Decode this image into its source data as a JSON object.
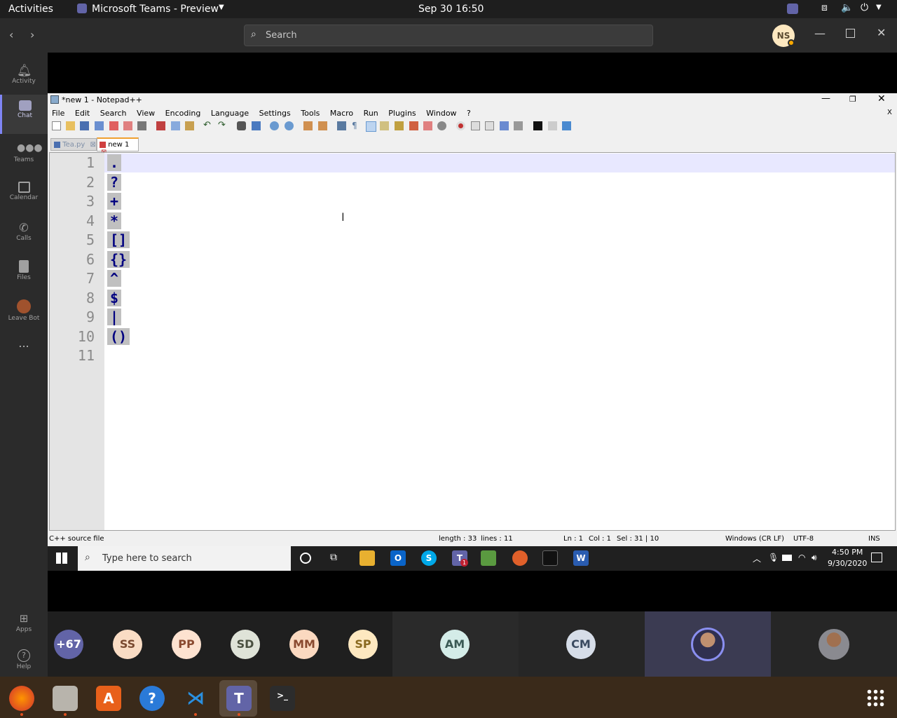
{
  "topbar": {
    "activities": "Activities",
    "app_name": "Microsoft Teams - Preview",
    "datetime": "Sep 30  16:50"
  },
  "teams": {
    "search_placeholder": "Search",
    "user_initials": "NS",
    "rail": [
      {
        "label": "Activity"
      },
      {
        "label": "Chat"
      },
      {
        "label": "Teams"
      },
      {
        "label": "Calendar"
      },
      {
        "label": "Calls"
      },
      {
        "label": "Files"
      },
      {
        "label": "Leave Bot"
      }
    ],
    "apps_label": "Apps",
    "help_label": "Help",
    "more_label": "..."
  },
  "notepad": {
    "title": "*new 1 - Notepad++",
    "menu": [
      "File",
      "Edit",
      "Search",
      "View",
      "Encoding",
      "Language",
      "Settings",
      "Tools",
      "Macro",
      "Run",
      "Plugins",
      "Window",
      "?"
    ],
    "tabs": [
      {
        "label": "Tea.py"
      },
      {
        "label": "new 1"
      }
    ],
    "line_numbers": [
      "1",
      "2",
      "3",
      "4",
      "5",
      "6",
      "7",
      "8",
      "9",
      "10",
      "11"
    ],
    "lines": [
      ".",
      "?",
      "+",
      "*",
      "[]",
      "{}",
      "^",
      "$",
      "|",
      "()",
      ""
    ],
    "status": {
      "type": "C++ source file",
      "length": "length : 33",
      "lines": "lines : 11",
      "ln": "Ln : 1",
      "col": "Col : 1",
      "sel": "Sel : 31 | 10",
      "eol": "Windows (CR LF)",
      "encoding": "UTF-8",
      "mode": "INS"
    }
  },
  "windows_taskbar": {
    "search_placeholder": "Type here to search",
    "time": "4:50 PM",
    "date": "9/30/2020",
    "teams_badge": "1"
  },
  "participants": [
    {
      "initials": "+67",
      "color": "#6264a7"
    },
    {
      "initials": "SS",
      "color": "#f9dcc4"
    },
    {
      "initials": "PP",
      "color": "#fde2d0"
    },
    {
      "initials": "SD",
      "color": "#dfe3d8"
    },
    {
      "initials": "MM",
      "color": "#fbd9c0"
    },
    {
      "initials": "SP",
      "color": "#fde8c0"
    },
    {
      "initials": "AM",
      "color": "#d4ece8"
    },
    {
      "initials": "CM",
      "color": "#d6dde8"
    }
  ]
}
